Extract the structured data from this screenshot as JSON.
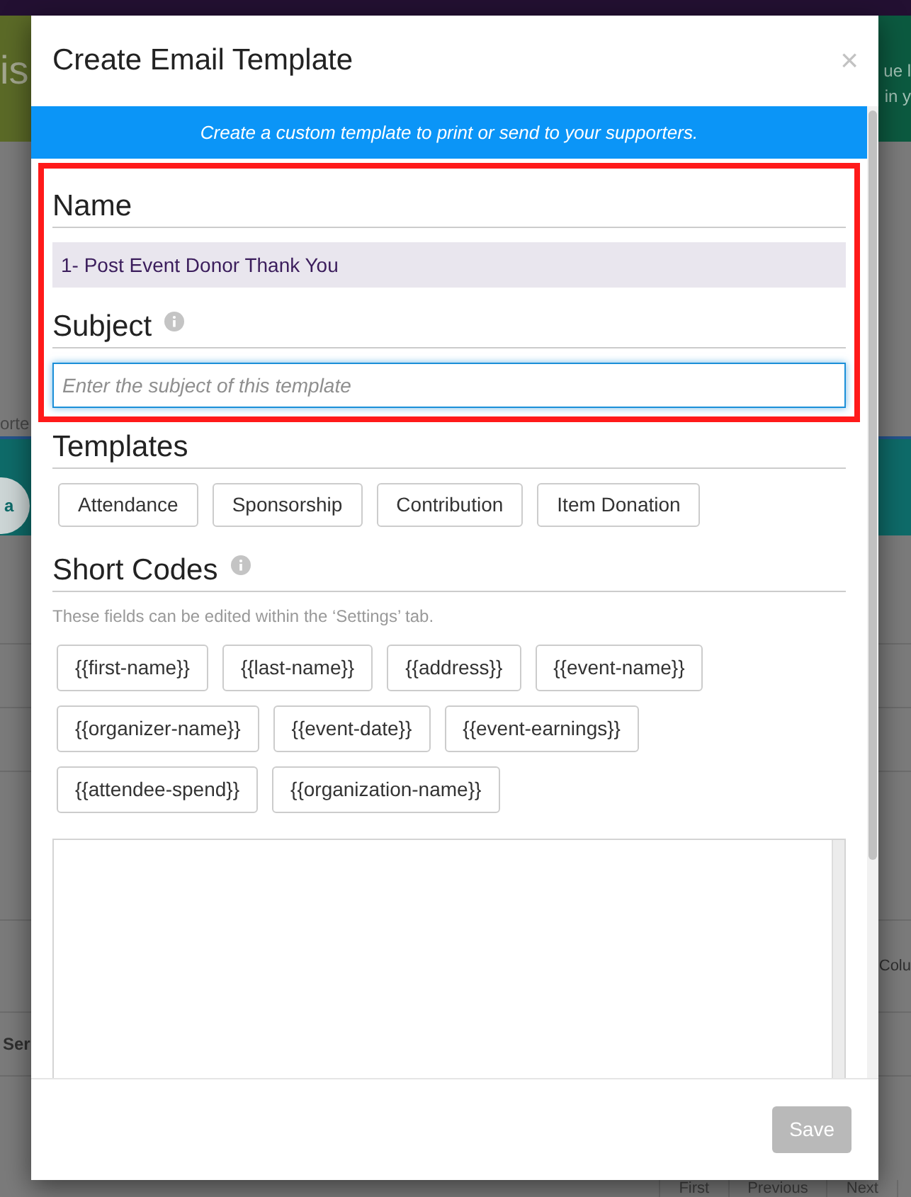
{
  "background": {
    "banner_left_text": "is",
    "banner_right_lines": [
      "ue l",
      "in y"
    ],
    "section_label": "orte",
    "pill_button": "a",
    "column_text": "Colu",
    "row_label": "Ser",
    "pagination": [
      "First",
      "Previous",
      "Next"
    ]
  },
  "dialog": {
    "title": "Create Email Template",
    "close_glyph": "×",
    "banner": "Create a custom template to print or send to your supporters.",
    "fields_highlighted": true,
    "fields": [
      {
        "kind": "readonly",
        "label": "Name",
        "info_icon": false,
        "value": "1- Post Event Donor Thank You"
      },
      {
        "kind": "input",
        "label": "Subject",
        "info_icon": true,
        "placeholder": "Enter the subject of this template",
        "focused": true
      }
    ],
    "templates": {
      "heading": "Templates",
      "info_icon": false,
      "buttons": [
        "Attendance",
        "Sponsorship",
        "Contribution",
        "Item Donation"
      ]
    },
    "short_codes": {
      "heading": "Short Codes",
      "info_icon": true,
      "hint": "These fields can be edited within the ‘Settings’ tab.",
      "codes": [
        "{{first-name}}",
        "{{last-name}}",
        "{{address}}",
        "{{event-name}}",
        "{{organizer-name}}",
        "{{event-date}}",
        "{{event-earnings}}",
        "{{attendee-spend}}",
        "{{organization-name}}"
      ]
    },
    "footer": {
      "save": {
        "label": "Save",
        "disabled": true
      }
    }
  }
}
